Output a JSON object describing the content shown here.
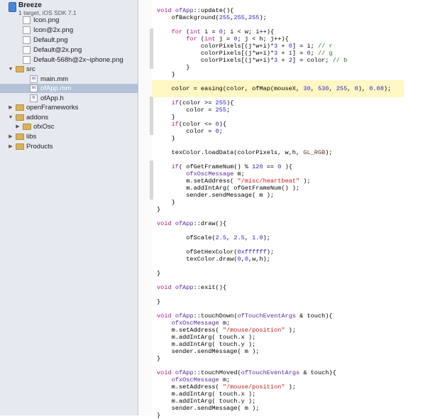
{
  "project": {
    "name": "Breeze",
    "subtitle": "1 target, iOS SDK 7.1"
  },
  "navigator": [
    {
      "label": "Icon.png",
      "icon": "png-file-icon"
    },
    {
      "label": "Icon@2x.png",
      "icon": "png-file-icon"
    },
    {
      "label": "Default.png",
      "icon": "png-file-icon"
    },
    {
      "label": "Default@2x.png",
      "icon": "png-file-icon"
    },
    {
      "label": "Default-568h@2x~iphone.png",
      "icon": "png-file-icon"
    },
    {
      "label": "src",
      "icon": "folder-icon",
      "disclosure": "▼"
    },
    {
      "label": "main.mm",
      "icon": "mm-file-icon",
      "badge": "m"
    },
    {
      "label": "ofApp.mm",
      "icon": "mm-file-icon",
      "badge": "m",
      "selected": true
    },
    {
      "label": "ofApp.h",
      "icon": "header-file-icon",
      "badge": "h"
    },
    {
      "label": "openFrameworks",
      "icon": "folder-icon",
      "disclosure": "▶"
    },
    {
      "label": "addons",
      "icon": "folder-icon",
      "disclosure": "▼"
    },
    {
      "label": "ofxOsc",
      "icon": "folder-icon",
      "disclosure": "▶"
    },
    {
      "label": "libs",
      "icon": "folder-icon",
      "disclosure": "▶"
    },
    {
      "label": "Products",
      "icon": "folder-icon",
      "disclosure": "▶"
    }
  ],
  "code": [
    "void ofApp::update(){",
    "    ofBackground(255,255,255);",
    "",
    "    for (int i = 0; i < w; i++){",
    "        for (int j = 0; j < h; j++){",
    "            colorPixels[(j*w+i)*3 + 0] = i; // r",
    "            colorPixels[(j*w+i)*3 + 1] = 0; // g",
    "            colorPixels[(j*w+i)*3 + 2] = color; // b",
    "        }",
    "    }",
    "",
    "    color = easing(color, ofMap(mouseX, 30, 530, 255, 0), 0.08);",
    "",
    "    if(color >= 255){",
    "        color = 255;",
    "    }",
    "    if(color <= 0){",
    "        color = 0;",
    "    }",
    "",
    "    texColor.loadData(colorPixels, w,h, GL_RGB);",
    "",
    "    if( ofGetFrameNum() % 120 == 0 ){",
    "        ofxOscMessage m;",
    "        m.setAddress( \"/misc/heartbeat\" );",
    "        m.addIntArg( ofGetFrameNum() );",
    "        sender.sendMessage( m );",
    "    }",
    "}",
    "",
    "void ofApp::draw(){",
    "",
    "        ofScale(2.5, 2.5, 1.0);",
    "",
    "        ofSetHexColor(0xffffff);",
    "        texColor.draw(0,0,w,h);",
    "",
    "}",
    "",
    "void ofApp::exit(){",
    "",
    "}",
    "",
    "void ofApp::touchDown(ofTouchEventArgs & touch){",
    "    ofxOscMessage m;",
    "    m.setAddress( \"/mouse/position\" );",
    "    m.addIntArg( touch.x );",
    "    m.addIntArg( touch.y );",
    "    sender.sendMessage( m );",
    "}",
    "",
    "void ofApp::touchMoved(ofTouchEventArgs & touch){",
    "    ofxOscMessage m;",
    "    m.setAddress( \"/mouse/position\" );",
    "    m.addIntArg( touch.x );",
    "    m.addIntArg( touch.y );",
    "    sender.sendMessage( m );",
    "}"
  ],
  "highlighted_line": 11,
  "colors": {
    "keyword": "#b5168b",
    "number": "#2b21c9",
    "string": "#c41a16",
    "comment": "#1c7a1c",
    "highlight": "#fff7c4",
    "selection": "#b3c2d8"
  }
}
